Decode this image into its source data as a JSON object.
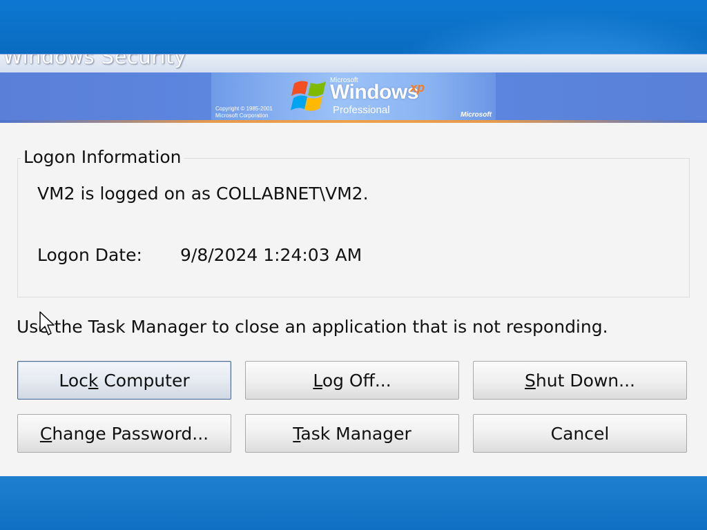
{
  "window": {
    "title": "Windows Security"
  },
  "banner": {
    "brand_small": "Microsoft",
    "product": "Windows",
    "product_suffix": "xp",
    "edition": "Professional",
    "copyright": "Copyright © 1985-2001\nMicrosoft Corporation",
    "maker": "Microsoft"
  },
  "logon_info": {
    "group_title": "Logon Information",
    "logged_on_text": "VM2 is logged on as COLLABNET\\VM2.",
    "date_label": "Logon Date:",
    "date_value": "9/8/2024 1:24:03 AM"
  },
  "hint": "Use the Task Manager to close an application that is not responding.",
  "buttons": {
    "lock": {
      "pre": "Loc",
      "key": "k",
      "post": " Computer"
    },
    "logoff": {
      "pre": "",
      "key": "L",
      "post": "og Off..."
    },
    "shutdown": {
      "pre": "",
      "key": "S",
      "post": "hut Down..."
    },
    "change_password": {
      "pre": "",
      "key": "C",
      "post": "hange Password..."
    },
    "task_manager": {
      "pre": "",
      "key": "T",
      "post": "ask Manager"
    },
    "cancel": {
      "pre": "",
      "key": "",
      "post": "Cancel"
    }
  },
  "colors": {
    "desktop": "#0a6fc4",
    "banner": "#5b85de",
    "dialog_bg": "#f4f4f4",
    "xp_accent": "#ff7a1a"
  },
  "icons": {
    "windows_flag": "windows-flag-icon",
    "cursor": "mouse-pointer-icon"
  }
}
